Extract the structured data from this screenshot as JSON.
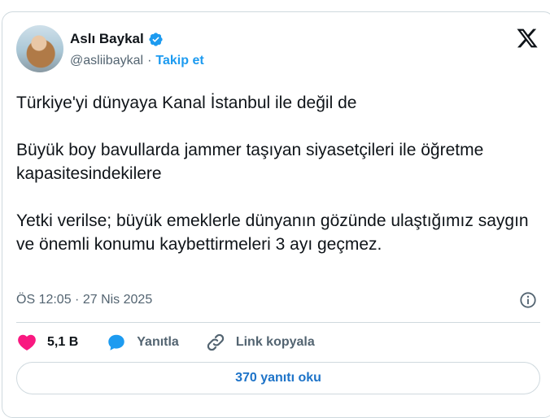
{
  "author": {
    "name": "Aslı Baykal",
    "handle": "@asliibaykal",
    "separator": "·",
    "follow_label": "Takip et"
  },
  "tweet": {
    "paragraphs": [
      "Türkiye'yi dünyaya Kanal İstanbul ile değil de",
      "Büyük boy bavullarda jammer taşıyan siyasetçileri ile öğretme kapasitesindekilere",
      "Yetki verilse; büyük emeklerle dünyanın gözünde ulaştığımız saygın ve önemli konumu kaybettirmeleri 3 ayı geçmez."
    ],
    "timestamp": "ÖS 12:05 · 27 Nis 2025"
  },
  "actions": {
    "likes": "5,1 B",
    "reply_label": "Yanıtla",
    "copy_link_label": "Link kopyala"
  },
  "replies_button": "370 yanıtı oku",
  "icons": {
    "verified": "verified-badge-icon",
    "logo": "x-logo-icon",
    "info": "info-icon",
    "like": "heart-icon",
    "reply": "reply-bubble-icon",
    "link": "link-icon"
  },
  "colors": {
    "accent": "#1d9bf0",
    "like": "#f91880",
    "text": "#0f1419",
    "muted": "#536471",
    "border": "#cfd9de"
  }
}
